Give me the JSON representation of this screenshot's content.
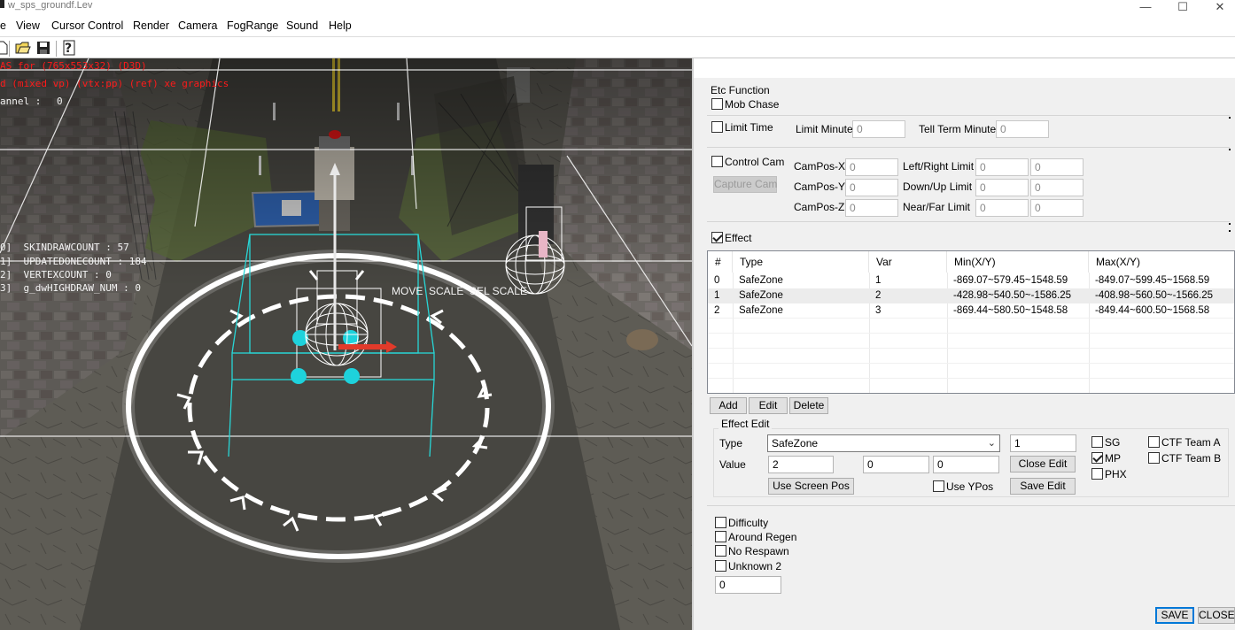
{
  "window": {
    "title": "w_sps_groundf.Lev"
  },
  "menu": {
    "items": [
      "e",
      "View",
      "Cursor Control",
      "Render",
      "Camera",
      "FogRange",
      "Sound",
      "Help"
    ]
  },
  "toolbar": {
    "icons": [
      "new-file-icon",
      "open-folder-icon",
      "save-disk-icon",
      "help-icon"
    ]
  },
  "viewport": {
    "overlay_red_1": "AS for (765x553x32) (D3D)",
    "overlay_red_2": "d (mixed vp) (vtx:pp) (ref) xe graphics",
    "channel_label": "annel :",
    "channel_value": "0",
    "stats": [
      "0]  SKINDRAWCOUNT : 57",
      "1]  UPDATEDONECOUNT : 184",
      "2]  VERTEXCOUNT : 0",
      "3]  g_dwHIGHDRAW_NUM : 0"
    ],
    "gizmo_label": "MOVE  SCALE  SEL SCALE"
  },
  "panel": {
    "etc_function_label": "Etc Function",
    "mob_chase": {
      "label": "Mob Chase",
      "checked": false
    },
    "limit_time": {
      "label": "Limit Time",
      "checked": false,
      "limit_minute_label": "Limit Minute",
      "limit_minute_value": "0",
      "tell_term_label": "Tell Term Minute",
      "tell_term_value": "0"
    },
    "control_cam": {
      "label": "Control Cam",
      "checked": false,
      "capture_button": "Capture Cam",
      "campos_x_label": "CamPos-X",
      "campos_x": "0",
      "campos_y_label": "CamPos-Y",
      "campos_y": "0",
      "campos_z_label": "CamPos-Z",
      "campos_z": "0",
      "lr_label": "Left/Right Limit",
      "lr_1": "0",
      "lr_2": "0",
      "du_label": "Down/Up Limit",
      "du_1": "0",
      "du_2": "0",
      "nf_label": "Near/Far Limit",
      "nf_1": "0",
      "nf_2": "0"
    },
    "effect": {
      "label": "Effect",
      "checked": true,
      "columns": [
        "#",
        "Type",
        "Var",
        "Min(X/Y)",
        "Max(X/Y)"
      ],
      "rows": [
        [
          "0",
          "SafeZone",
          "1",
          "-869.07~579.45~1548.59",
          "-849.07~599.45~1568.59"
        ],
        [
          "1",
          "SafeZone",
          "2",
          "-428.98~540.50~-1586.25",
          "-408.98~560.50~-1566.25"
        ],
        [
          "2",
          "SafeZone",
          "3",
          "-869.44~580.50~1548.58",
          "-849.44~600.50~1568.58"
        ]
      ],
      "add_button": "Add",
      "edit_button": "Edit",
      "delete_button": "Delete"
    },
    "effect_edit": {
      "group_label": "Effect Edit",
      "type_label": "Type",
      "type_value": "SafeZone",
      "type_num": "1",
      "value_label": "Value",
      "value_1": "2",
      "value_2": "0",
      "value_3": "0",
      "close_edit_button": "Close Edit",
      "save_edit_button": "Save Edit",
      "use_screen_pos_button": "Use Screen Pos",
      "use_ypos": {
        "label": "Use YPos",
        "checked": false
      },
      "sg": {
        "label": "SG",
        "checked": false
      },
      "mp": {
        "label": "MP",
        "checked": true
      },
      "phx": {
        "label": "PHX",
        "checked": false
      },
      "ctf_a": {
        "label": "CTF Team A",
        "checked": false
      },
      "ctf_b": {
        "label": "CTF Team B",
        "checked": false
      }
    },
    "difficulty": {
      "label": "Difficulty",
      "checked": false
    },
    "around_regen": {
      "label": "Around Regen",
      "checked": false
    },
    "no_respawn": {
      "label": "No Respawn",
      "checked": false
    },
    "unknown_2": {
      "label": "Unknown 2",
      "checked": false
    },
    "bottom_value": "0",
    "save_button": "SAVE",
    "close_button": "CLOSE"
  }
}
